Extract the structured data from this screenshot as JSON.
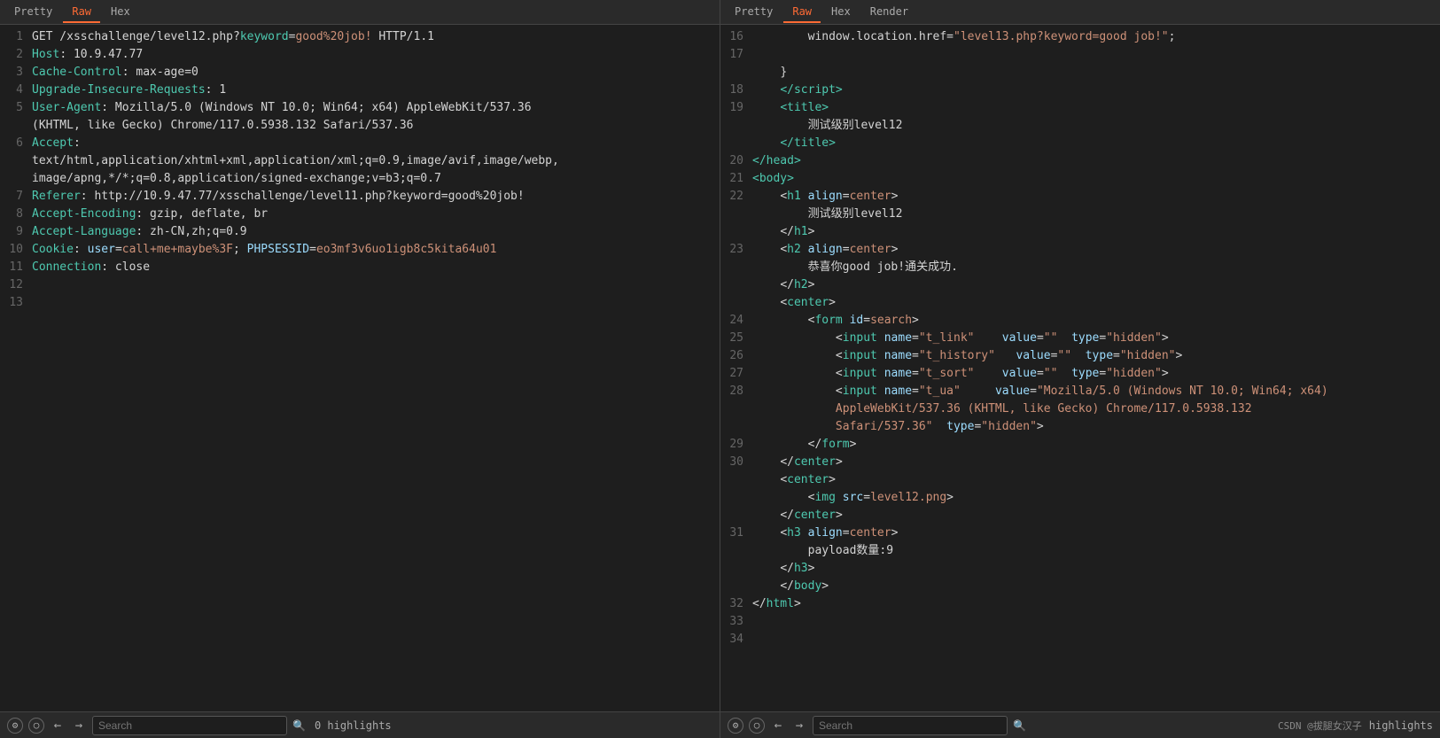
{
  "panes": [
    {
      "id": "left",
      "tabs": [
        {
          "label": "Pretty",
          "active": false
        },
        {
          "label": "Raw",
          "active": true
        },
        {
          "label": "Hex",
          "active": false
        }
      ],
      "lines": [
        {
          "num": 1,
          "type": "http-request",
          "content": "GET /xsschallenge/level12.php?keyword=good%20job! HTTP/1.1"
        },
        {
          "num": 2,
          "type": "http-header",
          "key": "Host",
          "val": " 10.9.47.77"
        },
        {
          "num": 3,
          "type": "http-header",
          "key": "Cache-Control",
          "val": " max-age=0"
        },
        {
          "num": 4,
          "type": "http-header",
          "key": "Upgrade-Insecure-Requests",
          "val": " 1"
        },
        {
          "num": 5,
          "type": "http-header",
          "key": "User-Agent",
          "val": " Mozilla/5.0 (Windows NT 10.0; Win64; x64) AppleWebKit/537.36\n(KHTML, like Gecko) Chrome/117.0.5938.132 Safari/537.36"
        },
        {
          "num": 6,
          "type": "http-header",
          "key": "Accept",
          "val": "\ntext/html,application/xhtml+xml,application/xml;q=0.9,image/avif,image/webp,\nimage/apng,*/*;q=0.8,application/signed-exchange;v=b3;q=0.7"
        },
        {
          "num": 7,
          "type": "http-header",
          "key": "Referer",
          "val": " http://10.9.47.77/xsschallenge/level11.php?keyword=good%20job!"
        },
        {
          "num": 8,
          "type": "http-header",
          "key": "Accept-Encoding",
          "val": " gzip, deflate, br"
        },
        {
          "num": 9,
          "type": "http-header",
          "key": "Accept-Language",
          "val": " zh-CN,zh;q=0.9"
        },
        {
          "num": 10,
          "type": "http-header-cookie",
          "key": "Cookie",
          "val": " user=call+me+maybe%3F; PHPSESSID=eo3mf3v6uo1igb8c5kita64u01"
        },
        {
          "num": 11,
          "type": "http-header",
          "key": "Connection",
          "val": " close"
        },
        {
          "num": 12,
          "type": "empty"
        },
        {
          "num": 13,
          "type": "empty"
        }
      ]
    },
    {
      "id": "right",
      "tabs": [
        {
          "label": "Pretty",
          "active": false
        },
        {
          "label": "Raw",
          "active": true
        },
        {
          "label": "Hex",
          "active": false
        },
        {
          "label": "Render",
          "active": false
        }
      ],
      "lines": [
        {
          "num": 16,
          "html": "        window.location.href=<span class='html-string'>\"level13.php?keyword=good job!\"</span>;"
        },
        {
          "num": 17,
          "html": ""
        },
        {
          "num": 17,
          "html": "    }"
        },
        {
          "num": 18,
          "html": "    &lt;/script&gt;"
        },
        {
          "num": 19,
          "html": "    &lt;title&gt;"
        },
        {
          "num": "",
          "html": "        &#x6D4B;&#x8BD5;&#x7EA7;&#x522B;level12"
        },
        {
          "num": "",
          "html": "    &lt;/title&gt;"
        },
        {
          "num": 20,
          "html": "&lt;/head&gt;"
        },
        {
          "num": 21,
          "html": "&lt;body&gt;"
        },
        {
          "num": 22,
          "html": "    &lt;<span class='html-tag'>h1</span> <span class='html-attr'>align</span>=<span class='html-val'>center</span>&gt;"
        },
        {
          "num": "",
          "html": "        &#x6D4B;&#x8BD5;&#x7EA7;&#x522B;level12"
        },
        {
          "num": "",
          "html": "    &lt;/h1&gt;"
        },
        {
          "num": 23,
          "html": "    &lt;<span class='html-tag'>h2</span> <span class='html-attr'>align</span>=<span class='html-val'>center</span>&gt;"
        },
        {
          "num": "",
          "html": "        &#x606D;&#x559C;&#x4F60;good job!&#x901A;&#x5173;&#x6210;&#x529F;."
        },
        {
          "num": "",
          "html": "    &lt;/h2&gt;"
        },
        {
          "num": "",
          "html": "    &lt;<span class='html-tag'>center</span>&gt;"
        },
        {
          "num": 24,
          "html": "        &lt;<span class='html-tag'>form</span> <span class='html-attr'>id</span>=<span class='html-val'>search</span>&gt;"
        },
        {
          "num": 25,
          "html": "            &lt;<span class='html-tag'>input</span> <span class='html-attr'>name</span>=<span class='html-val'>\"t_link\"</span>   <span class='html-attr'>value</span>=<span class='html-val'>\"\"</span>  <span class='html-attr'>type</span>=<span class='html-val'>\"hidden\"</span>&gt;"
        },
        {
          "num": 26,
          "html": "            &lt;<span class='html-tag'>input</span> <span class='html-attr'>name</span>=<span class='html-val'>\"t_history\"</span>  <span class='html-attr'>value</span>=<span class='html-val'>\"\"</span>  <span class='html-attr'>type</span>=<span class='html-val'>\"hidden\"</span>&gt;"
        },
        {
          "num": 27,
          "html": "            &lt;<span class='html-tag'>input</span> <span class='html-attr'>name</span>=<span class='html-val'>\"t_sort\"</span>    <span class='html-attr'>value</span>=<span class='html-val'>\"\"</span>  <span class='html-attr'>type</span>=<span class='html-val'>\"hidden\"</span>&gt;"
        },
        {
          "num": 28,
          "html": "            &lt;<span class='html-tag'>input</span> <span class='html-attr'>name</span>=<span class='html-val'>\"t_ua\"</span>     <span class='html-attr'>value</span>=<span class='html-val'>\"Mozilla/5.0 (Windows NT 10.0; Win64; x64)</span>"
        },
        {
          "num": "",
          "html": "            <span class='html-val'>AppleWebKit/537.36 (KHTML, like Gecko) Chrome/117.0.5938.132</span>"
        },
        {
          "num": "",
          "html": "            <span class='html-val'>Safari/537.36\"</span>  <span class='html-attr'>type</span>=<span class='html-val'>\"hidden\"</span>&gt;"
        },
        {
          "num": 29,
          "html": "        &lt;/form&gt;"
        },
        {
          "num": 30,
          "html": "    &lt;/center&gt;"
        },
        {
          "num": "",
          "html": "    &lt;<span class='html-tag'>center</span>&gt;"
        },
        {
          "num": "",
          "html": "        &lt;<span class='html-tag'>img</span> <span class='html-attr'>src</span>=<span class='html-val'>level12.png</span>&gt;"
        },
        {
          "num": "",
          "html": "    &lt;/center&gt;"
        },
        {
          "num": 31,
          "html": "    &lt;<span class='html-tag'>h3</span> <span class='html-attr'>align</span>=<span class='html-val'>center</span>&gt;"
        },
        {
          "num": "",
          "html": "        payload&#x6570;&#x91CF;:9"
        },
        {
          "num": "",
          "html": "    &lt;/h3&gt;"
        },
        {
          "num": "",
          "html": "    &lt;/body&gt;"
        },
        {
          "num": 32,
          "html": "&lt;/html&gt;"
        },
        {
          "num": 33,
          "html": ""
        },
        {
          "num": 34,
          "html": ""
        }
      ]
    }
  ],
  "status_bars": [
    {
      "search_placeholder": "Search",
      "highlights_count": "0 highlights"
    },
    {
      "search_placeholder": "Search",
      "watermark": "CSDN @拔腿女汉子",
      "highlights_label": "highlights"
    }
  ]
}
